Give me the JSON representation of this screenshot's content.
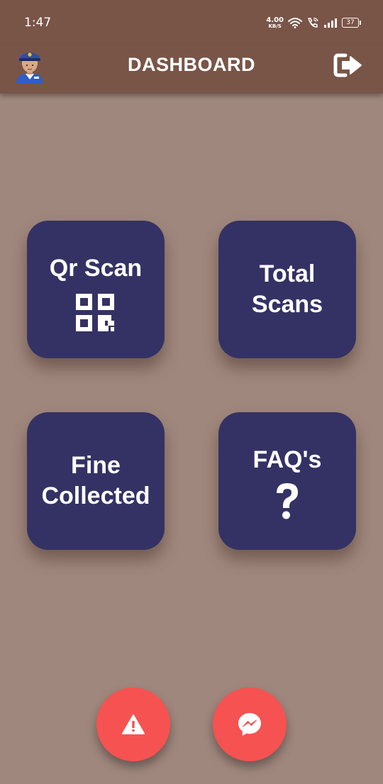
{
  "status_bar": {
    "time": "1:47",
    "net_speed_value": "4.00",
    "net_speed_unit": "KB/S",
    "battery": "37"
  },
  "app_bar": {
    "title": "DASHBOARD",
    "avatar_icon": "police-officer-icon",
    "logout_icon": "logout-icon"
  },
  "tiles": [
    {
      "label": "Qr Scan",
      "icon": "qr-code-icon"
    },
    {
      "label": "Total Scans"
    },
    {
      "label": "Fine Collected"
    },
    {
      "label": "FAQ's",
      "icon": "question-mark-icon"
    }
  ],
  "fabs": [
    {
      "icon": "warning-icon"
    },
    {
      "icon": "messenger-icon"
    }
  ],
  "colors": {
    "app_bar": "#795548",
    "background": "#a0877d",
    "tile": "#343264",
    "fab": "#f65251",
    "text": "#ffffff"
  }
}
